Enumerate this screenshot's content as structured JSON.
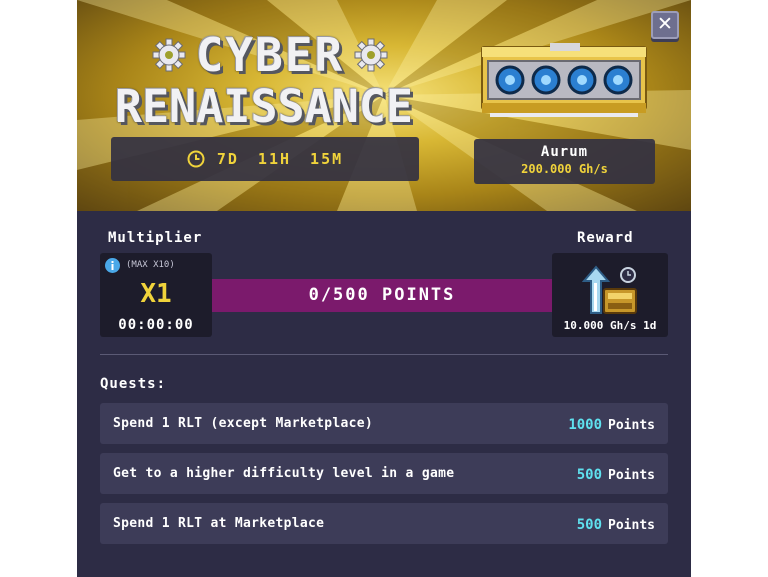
{
  "event": {
    "title_line1": "CYBER",
    "title_line2": "RENAISSANCE",
    "timer": "7D 11H 15M"
  },
  "close_label": "✕",
  "miner": {
    "name": "Aurum",
    "power": "200.000 Gh/s"
  },
  "progress": {
    "multiplier_label": "Multiplier",
    "max_label": "(MAX X10)",
    "multiplier_value": "X1",
    "multiplier_timer": "00:00:00",
    "points_text": "0/500 POINTS",
    "current_points": 0,
    "target_points": 500,
    "reward_label": "Reward",
    "reward_value": "10.000 Gh/s 1d"
  },
  "quests": {
    "title": "Quests:",
    "unit": "Points",
    "items": [
      {
        "description": "Spend 1 RLT (except Marketplace)",
        "points": "1000"
      },
      {
        "description": "Get to a higher difficulty level in a game",
        "points": "500"
      },
      {
        "description": "Spend 1 RLT at Marketplace",
        "points": "500"
      }
    ]
  },
  "colors": {
    "accent_yellow": "#f0d33b",
    "points_cyan": "#5fe0ee",
    "progress_magenta": "#7b1a6c",
    "panel_bg": "#2d2c45"
  },
  "icons": {
    "close": "close-icon",
    "clock": "clock-icon",
    "info": "info-icon",
    "gear": "gear-icon",
    "reward": "power-arrow-icon"
  }
}
